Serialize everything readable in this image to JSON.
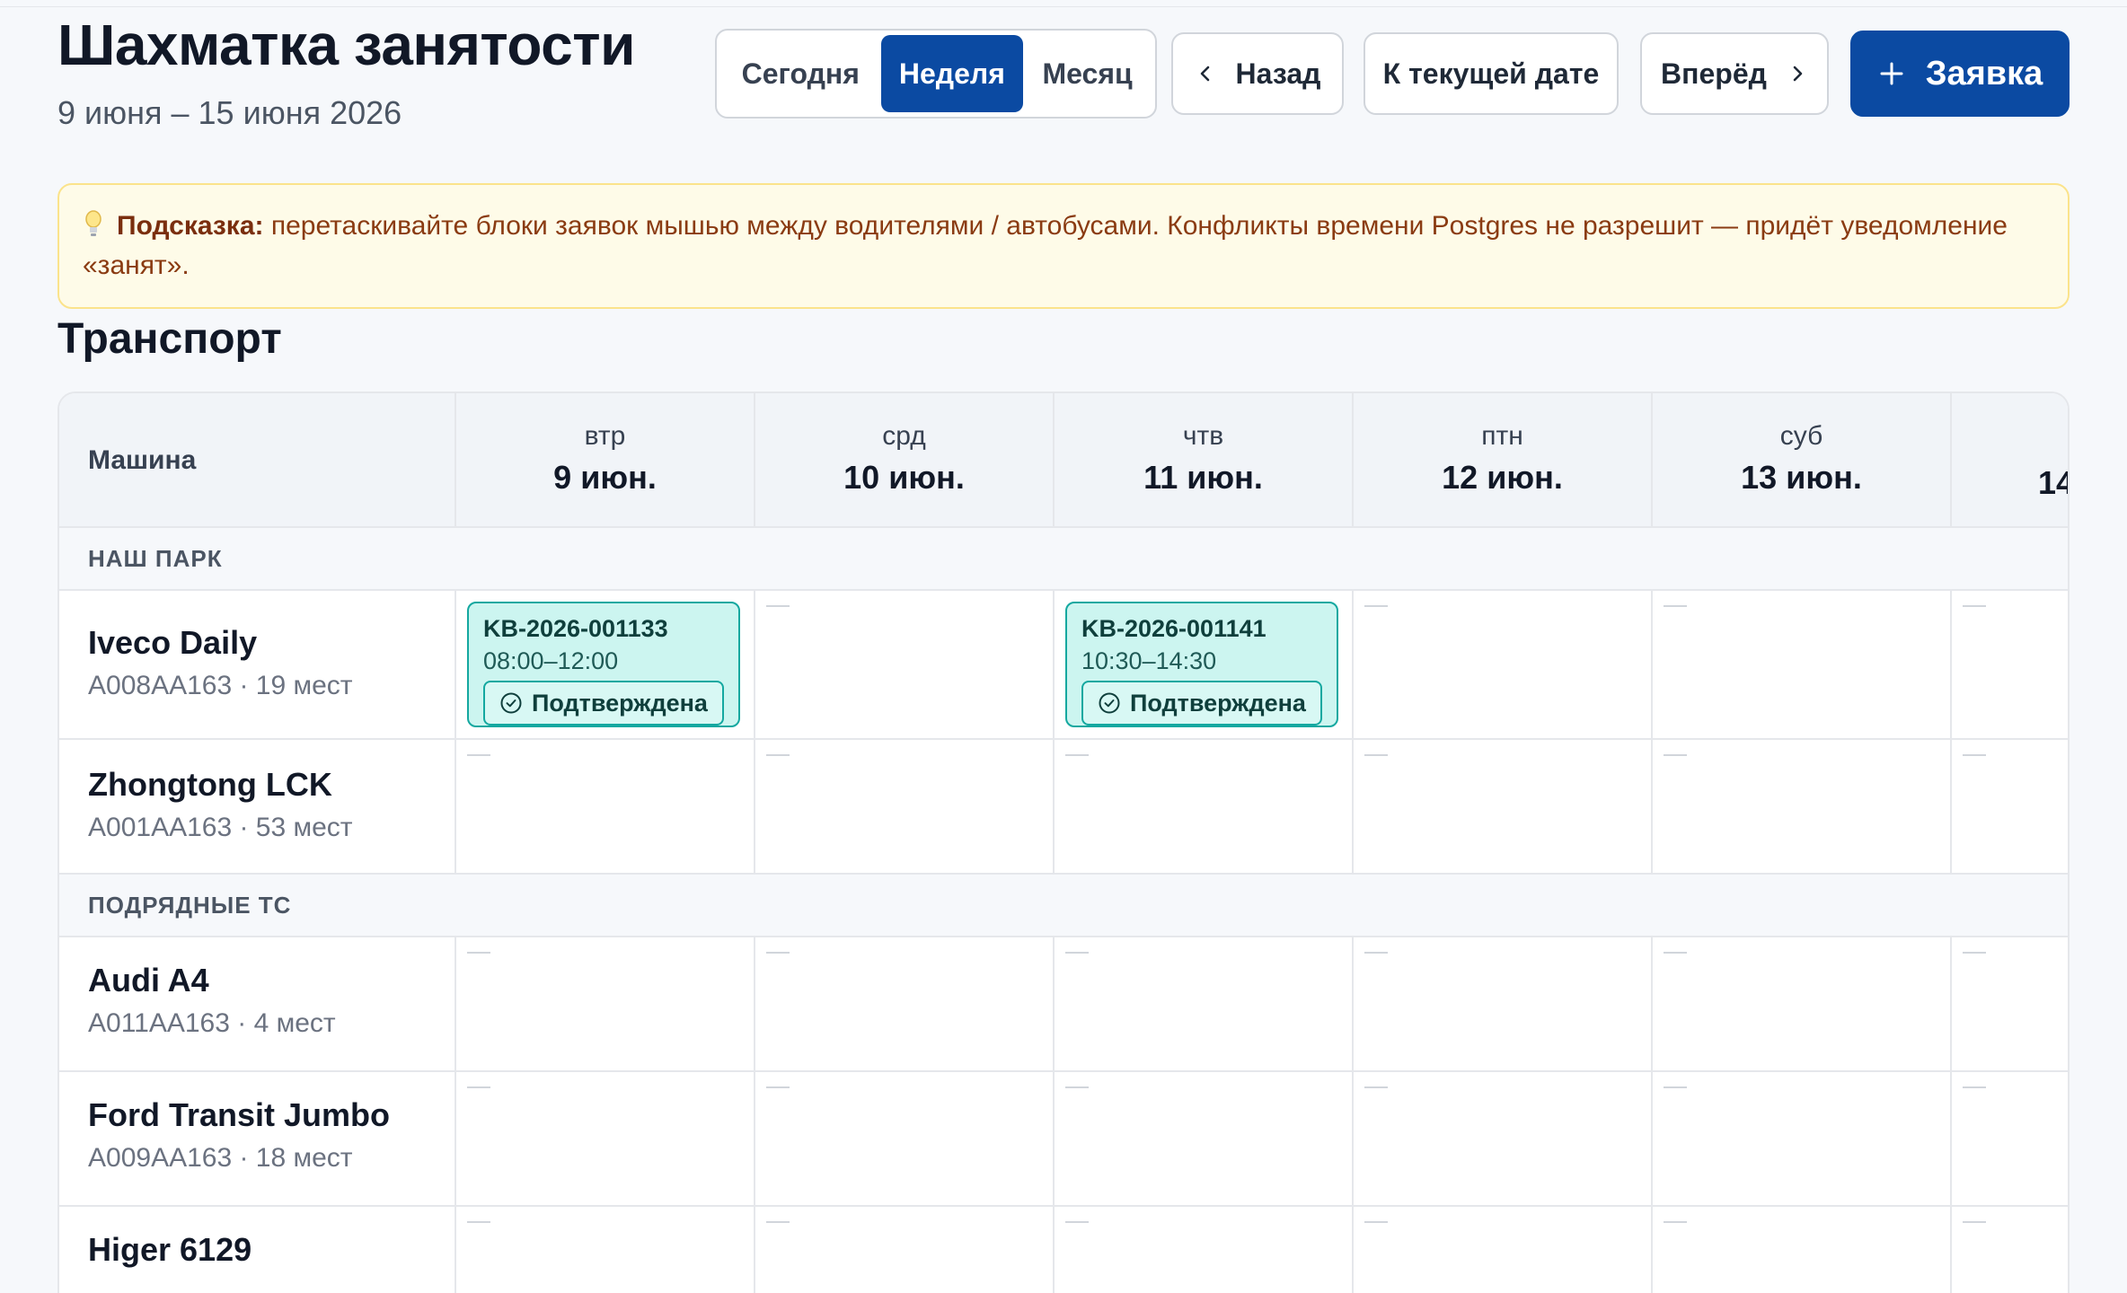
{
  "header": {
    "title": "Шахматка занятости",
    "subtitle": "9 июня – 15 июня 2026"
  },
  "view_switch": {
    "today": "Сегодня",
    "week": "Неделя",
    "month": "Месяц",
    "active": "week"
  },
  "nav": {
    "back": "Назад",
    "to_current": "К текущей дате",
    "forward": "Вперёд",
    "new_request": "Заявка"
  },
  "hint": {
    "label": "Подсказка:",
    "text": " перетаскивайте блоки заявок мышью между водителями / автобусами. Конфликты времени Postgres не разрешит — придёт уведомление «занят»."
  },
  "section_title": "Транспорт",
  "table": {
    "machine_header": "Машина",
    "days": [
      {
        "dow": "втр",
        "date": "9 июн."
      },
      {
        "dow": "срд",
        "date": "10 июн."
      },
      {
        "dow": "чтв",
        "date": "11 июн."
      },
      {
        "dow": "птн",
        "date": "12 июн."
      },
      {
        "dow": "суб",
        "date": "13 июн."
      },
      {
        "dow": "",
        "date": "14"
      }
    ],
    "groups": [
      {
        "label": "НАШ ПАРК",
        "vehicles": [
          {
            "name": "Iveco Daily",
            "sub": "А008АА163 · 19 мест"
          },
          {
            "name": "Zhongtong LCK",
            "sub": "А001АА163 · 53 мест"
          }
        ]
      },
      {
        "label": "ПОДРЯДНЫЕ ТС",
        "vehicles": [
          {
            "name": "Audi A4",
            "sub": "А011АА163 · 4 мест"
          },
          {
            "name": "Ford Transit Jumbo",
            "sub": "А009АА163 · 18 мест"
          },
          {
            "name": "Higer 6129",
            "sub": ""
          }
        ]
      }
    ],
    "bookings": [
      {
        "code": "KB-2026-001133",
        "time": "08:00–12:00",
        "status": "Подтверждена"
      },
      {
        "code": "KB-2026-001141",
        "time": "10:30–14:30",
        "status": "Подтверждена"
      }
    ]
  },
  "colors": {
    "primary": "#0b4aa2",
    "booking_bg": "#ccf5f0",
    "booking_border": "#14a8a0",
    "hint_bg": "#fefbe8",
    "hint_text": "#8a3b12"
  }
}
